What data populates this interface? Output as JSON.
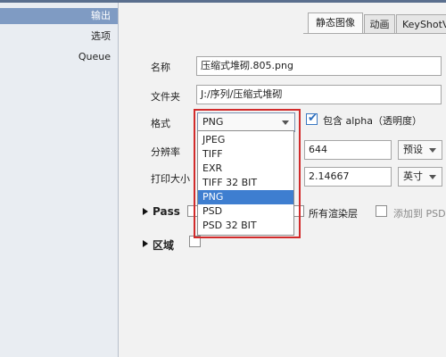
{
  "sidebar": {
    "items": [
      {
        "label": "输出",
        "selected": true
      },
      {
        "label": "选项",
        "selected": false
      },
      {
        "label": "Queue",
        "selected": false
      }
    ]
  },
  "tabs": [
    {
      "label": "静态图像",
      "active": true
    },
    {
      "label": "动画",
      "active": false
    },
    {
      "label": "KeyShotV",
      "active": false
    }
  ],
  "form": {
    "name_label": "名称",
    "name_value": "压缩式堆砌.805.png",
    "folder_label": "文件夹",
    "folder_value": "J:/序列/压缩式堆砌",
    "format_label": "格式",
    "format_value": "PNG",
    "alpha_label": "包含 alpha（透明度）",
    "alpha_checked": true,
    "resolution_label": "分辨率",
    "resolution_value": "644",
    "resolution_preset": "预设",
    "print_size_label": "打印大小",
    "print_size_value": "2.14667",
    "print_unit": "英寸",
    "pass_label": "Pass",
    "all_layers_label": "所有渲染层",
    "add_psd_label": "添加到 PSD",
    "region_label": "区域"
  },
  "format_options": [
    "JPEG",
    "TIFF",
    "EXR",
    "TIFF 32 BIT",
    "PNG",
    "PSD",
    "PSD 32 BIT"
  ],
  "format_selected": "PNG",
  "colors": {
    "highlight_box": "#d22b2b",
    "selection": "#3e7ed0",
    "sidebar_selected": "#7f9bc3"
  }
}
